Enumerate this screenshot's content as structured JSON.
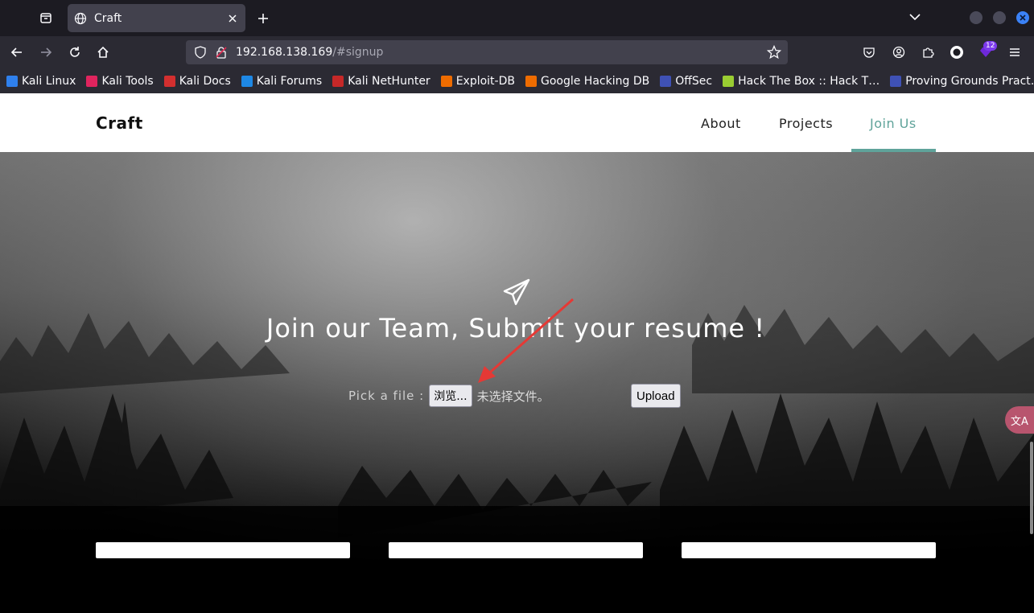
{
  "browser": {
    "tab_title": "Craft",
    "url_host": "192.168.138.169",
    "url_path": "/#signup",
    "extensions_badge": "12"
  },
  "bookmarks": [
    {
      "label": "Kali Linux",
      "color": "#2f80ed"
    },
    {
      "label": "Kali Tools",
      "color": "#e0245e"
    },
    {
      "label": "Kali Docs",
      "color": "#d32f2f"
    },
    {
      "label": "Kali Forums",
      "color": "#1e88e5"
    },
    {
      "label": "Kali NetHunter",
      "color": "#c62828"
    },
    {
      "label": "Exploit-DB",
      "color": "#ef6c00"
    },
    {
      "label": "Google Hacking DB",
      "color": "#ef6c00"
    },
    {
      "label": "OffSec",
      "color": "#3f51b5"
    },
    {
      "label": "Hack The Box :: Hack T…",
      "color": "#9acd32"
    },
    {
      "label": "Proving Grounds Pract…",
      "color": "#3f51b5"
    }
  ],
  "site": {
    "brand": "Craft",
    "nav": {
      "about": "About",
      "projects": "Projects",
      "join": "Join Us"
    },
    "accent_color": "#5fa39a"
  },
  "hero": {
    "headline": "Join our Team, Submit your resume !",
    "pick_label": "Pick a file :",
    "browse_label": "浏览...",
    "no_file_text": "未选择文件。",
    "upload_label": "Upload"
  },
  "translate_icon": "文A"
}
